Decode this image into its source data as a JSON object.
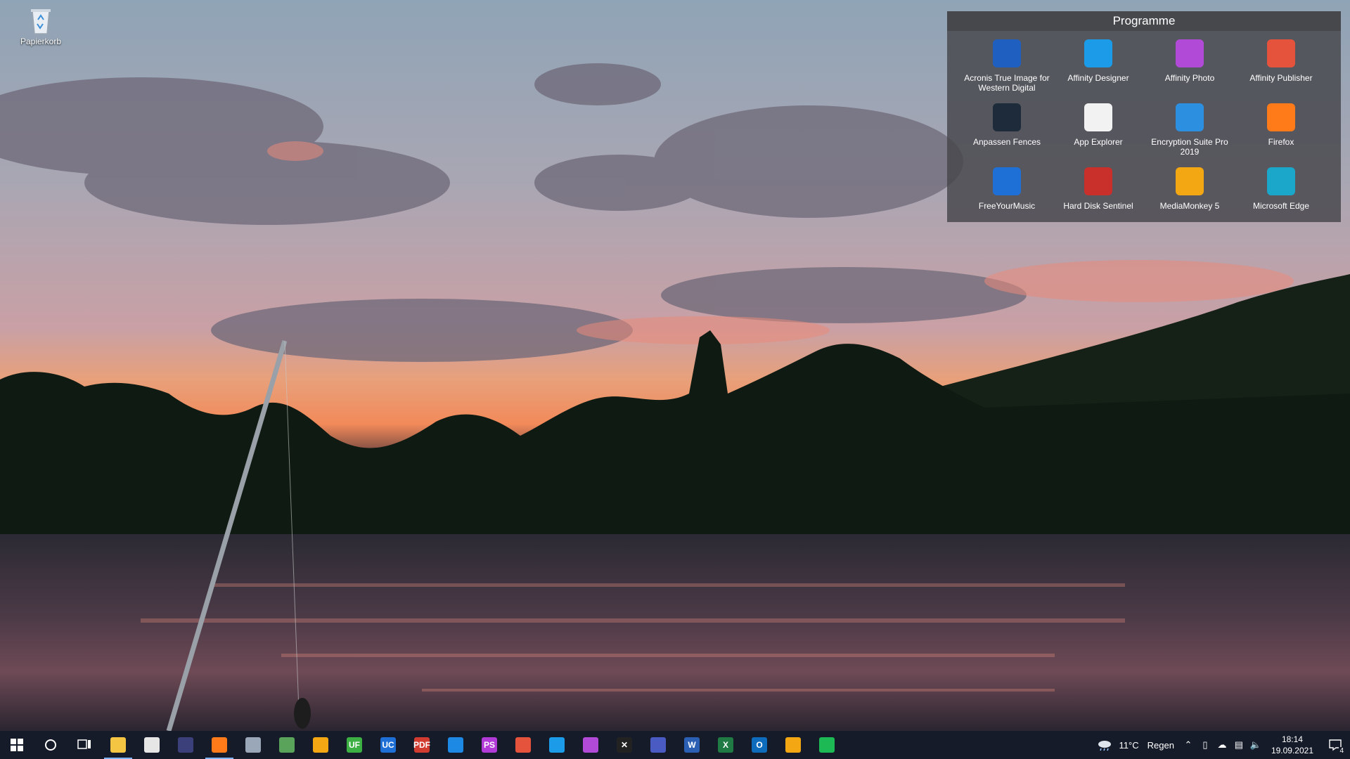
{
  "desktop": {
    "recycle_bin_label": "Papierkorb"
  },
  "fence": {
    "title": "Programme",
    "items": [
      {
        "label": "Acronis True Image for Western Digital",
        "icon": "acronis-icon",
        "color": "#1f5fbf"
      },
      {
        "label": "Affinity Designer",
        "icon": "affinity-designer-icon",
        "color": "#1b9be8"
      },
      {
        "label": "Affinity Photo",
        "icon": "affinity-photo-icon",
        "color": "#b14ad6"
      },
      {
        "label": "Affinity Publisher",
        "icon": "affinity-publisher-icon",
        "color": "#e5533c"
      },
      {
        "label": "Anpassen Fences",
        "icon": "fences-icon",
        "color": "#1d2b3a"
      },
      {
        "label": "App Explorer",
        "icon": "document-icon",
        "color": "#f2f2f2"
      },
      {
        "label": "Encryption Suite Pro 2019",
        "icon": "lock-icon",
        "color": "#2d8fe0"
      },
      {
        "label": "Firefox",
        "icon": "firefox-icon",
        "color": "#ff7a18"
      },
      {
        "label": "FreeYourMusic",
        "icon": "freeyourmusic-icon",
        "color": "#1e6fd6"
      },
      {
        "label": "Hard Disk Sentinel",
        "icon": "hard-disk-sentinel-icon",
        "color": "#c9302c"
      },
      {
        "label": "MediaMonkey 5",
        "icon": "mediamonkey-icon",
        "color": "#f3a712"
      },
      {
        "label": "Microsoft Edge",
        "icon": "edge-icon",
        "color": "#1aa7c9"
      }
    ]
  },
  "taskbar": {
    "apps": [
      {
        "name": "file-explorer",
        "glyph": "",
        "color": "#f4c542",
        "active": true
      },
      {
        "name": "microsoft-store",
        "glyph": "",
        "color": "#e6e6e6",
        "active": false
      },
      {
        "name": "password-manager",
        "glyph": "",
        "color": "#3b3f7a",
        "active": false
      },
      {
        "name": "firefox",
        "glyph": "",
        "color": "#ff7a18",
        "active": true
      },
      {
        "name": "remote-desktop",
        "glyph": "",
        "color": "#9aa7b8",
        "active": false
      },
      {
        "name": "network-tool",
        "glyph": "",
        "color": "#5aa35a",
        "active": false
      },
      {
        "name": "mediamonkey",
        "glyph": "",
        "color": "#f3a712",
        "active": false
      },
      {
        "name": "ultrafinder",
        "glyph": "UF",
        "color": "#3cb043",
        "active": false
      },
      {
        "name": "ultracompare",
        "glyph": "UC",
        "color": "#1e6fd6",
        "active": false
      },
      {
        "name": "pdf-tool",
        "glyph": "PDF",
        "color": "#d23b2f",
        "active": false
      },
      {
        "name": "vscode",
        "glyph": "",
        "color": "#1e88e5",
        "active": false
      },
      {
        "name": "phpstorm",
        "glyph": "PS",
        "color": "#b23ad8",
        "active": false
      },
      {
        "name": "affinity-publisher",
        "glyph": "",
        "color": "#e5533c",
        "active": false
      },
      {
        "name": "affinity-designer",
        "glyph": "",
        "color": "#1b9be8",
        "active": false
      },
      {
        "name": "affinity-photo",
        "glyph": "",
        "color": "#b14ad6",
        "active": false
      },
      {
        "name": "xmedia-tool",
        "glyph": "✕",
        "color": "#222222",
        "active": false
      },
      {
        "name": "disk-tool",
        "glyph": "",
        "color": "#4a5bc4",
        "active": false
      },
      {
        "name": "word",
        "glyph": "W",
        "color": "#2b5fb4",
        "active": false
      },
      {
        "name": "excel",
        "glyph": "X",
        "color": "#1f7a44",
        "active": false
      },
      {
        "name": "outlook",
        "glyph": "O",
        "color": "#0f6cbd",
        "active": false
      },
      {
        "name": "mediamonkey-2",
        "glyph": "",
        "color": "#f3a712",
        "active": false
      },
      {
        "name": "spotify",
        "glyph": "",
        "color": "#1db954",
        "active": false
      }
    ],
    "weather": {
      "temp": "11°C",
      "desc": "Regen"
    },
    "clock": {
      "time": "18:14",
      "date": "19.09.2021"
    },
    "notifications_count": "4"
  }
}
